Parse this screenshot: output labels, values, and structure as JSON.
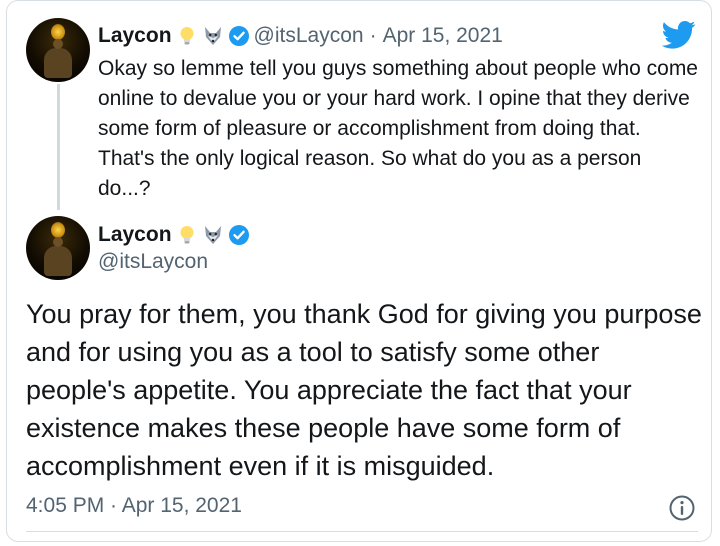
{
  "tweet_parent": {
    "display_name": "Laycon",
    "handle": "@itsLaycon",
    "separator": "·",
    "date": "Apr 15, 2021",
    "text": "Okay so lemme tell you guys something about people who come online to devalue you or your hard work. I opine that they derive some form of pleasure or accomplishment from doing that. That's the only logical reason. So what do you as a person do...?",
    "emojis": [
      "light-bulb-icon",
      "wolf-icon"
    ],
    "verified": true
  },
  "tweet_main": {
    "display_name": "Laycon",
    "handle": "@itsLaycon",
    "emojis": [
      "light-bulb-icon",
      "wolf-icon"
    ],
    "verified": true,
    "text": "You pray for them, you thank God for giving you purpose and for using you as a tool to satisfy some other people's appetite. You appreciate the fact that your existence makes these people have some form of accomplishment even if it is misguided.",
    "timestamp": "4:05 PM · Apr 15, 2021"
  },
  "colors": {
    "twitter_blue": "#1d9bf0",
    "text_primary": "#14171a",
    "text_secondary": "#536471"
  }
}
